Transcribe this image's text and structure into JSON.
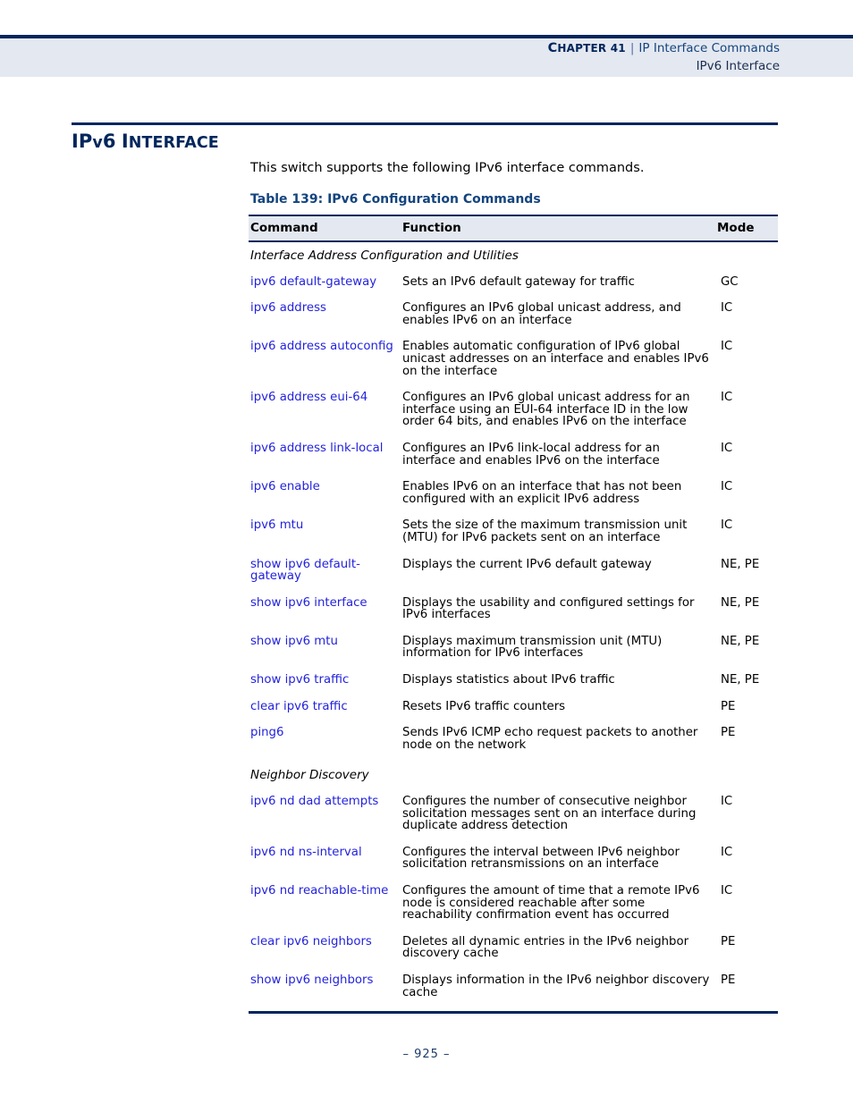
{
  "header": {
    "chapter_label": "Chapter",
    "chapter_number": "41",
    "separator": "|",
    "chapter_title": "IP Interface Commands",
    "section_name": "IPv6 Interface"
  },
  "section": {
    "title_prefix": "IP",
    "title_v": "v",
    "title_num": "6",
    "title_rest": "Interface",
    "title_plain": "IPv6 Interface"
  },
  "intro": {
    "paragraph": "This switch supports the following IPv6 interface commands."
  },
  "table": {
    "caption": "Table 139: IPv6 Configuration Commands",
    "columns": {
      "command": "Command",
      "function": "Function",
      "mode": "Mode"
    },
    "rows": [
      {
        "kind": "group",
        "label": "Interface Address Configuration and Utilities"
      },
      {
        "kind": "command",
        "command": "ipv6 default-gateway",
        "function": "Sets an IPv6 default gateway for traffic",
        "mode": "GC"
      },
      {
        "kind": "command",
        "command": "ipv6 address",
        "function": "Configures an IPv6 global unicast address, and enables IPv6 on an interface",
        "mode": "IC"
      },
      {
        "kind": "command",
        "command": "ipv6 address autoconfig",
        "function": "Enables automatic configuration of IPv6 global unicast addresses on an interface and enables IPv6 on the interface",
        "mode": "IC"
      },
      {
        "kind": "command",
        "command": "ipv6 address eui-64",
        "function": "Configures an IPv6 global unicast address for an interface using an EUI-64 interface ID in the low order 64 bits, and enables IPv6 on the interface",
        "mode": "IC"
      },
      {
        "kind": "command",
        "command": "ipv6 address link-local",
        "function": "Configures an IPv6 link-local address for an interface and enables IPv6 on the interface",
        "mode": "IC"
      },
      {
        "kind": "command",
        "command": "ipv6 enable",
        "function": "Enables IPv6 on an interface that has not been configured with an explicit IPv6 address",
        "mode": "IC"
      },
      {
        "kind": "command",
        "command": "ipv6 mtu",
        "function": "Sets the size of the maximum transmission unit (MTU) for IPv6 packets sent on an interface",
        "mode": "IC"
      },
      {
        "kind": "command",
        "command": "show ipv6 default-gateway",
        "function": "Displays the current IPv6 default gateway",
        "mode": "NE, PE"
      },
      {
        "kind": "command",
        "command": "show ipv6 interface",
        "function": "Displays the usability and configured settings for IPv6 interfaces",
        "mode": "NE, PE"
      },
      {
        "kind": "command",
        "command": "show ipv6 mtu",
        "function": "Displays maximum transmission unit (MTU) information for IPv6 interfaces",
        "mode": "NE, PE"
      },
      {
        "kind": "command",
        "command": "show ipv6 traffic",
        "function": "Displays statistics about IPv6 traffic",
        "mode": "NE, PE"
      },
      {
        "kind": "command",
        "command": "clear ipv6 traffic",
        "function": "Resets IPv6 traffic counters",
        "mode": "PE"
      },
      {
        "kind": "command",
        "command": "ping6",
        "function": "Sends IPv6 ICMP echo request packets to another node on the network",
        "mode": "PE"
      },
      {
        "kind": "group",
        "label": "Neighbor Discovery"
      },
      {
        "kind": "command",
        "command": "ipv6 nd dad attempts",
        "function": "Configures the number of consecutive neighbor solicitation messages sent on an interface during duplicate address detection",
        "mode": "IC"
      },
      {
        "kind": "command",
        "command": "ipv6 nd ns-interval",
        "function": "Configures the interval between IPv6 neighbor solicitation retransmissions on an interface",
        "mode": "IC"
      },
      {
        "kind": "command",
        "command": "ipv6 nd reachable-time",
        "function": "Configures the amount of time that a remote IPv6 node is considered reachable after some reachability confirmation event has occurred",
        "mode": "IC"
      },
      {
        "kind": "command",
        "command": "clear ipv6 neighbors",
        "function": "Deletes all dynamic entries in the IPv6 neighbor discovery cache",
        "mode": "PE"
      },
      {
        "kind": "command",
        "command": "show ipv6 neighbors",
        "function": "Displays information in the IPv6 neighbor discovery cache",
        "mode": "PE"
      }
    ]
  },
  "footer": {
    "page_number": "–  925  –"
  },
  "colors": {
    "navy": "#00265c",
    "header_band": "#e4e8f0",
    "link_blue": "#2323dd",
    "caption_blue": "#13447e"
  }
}
